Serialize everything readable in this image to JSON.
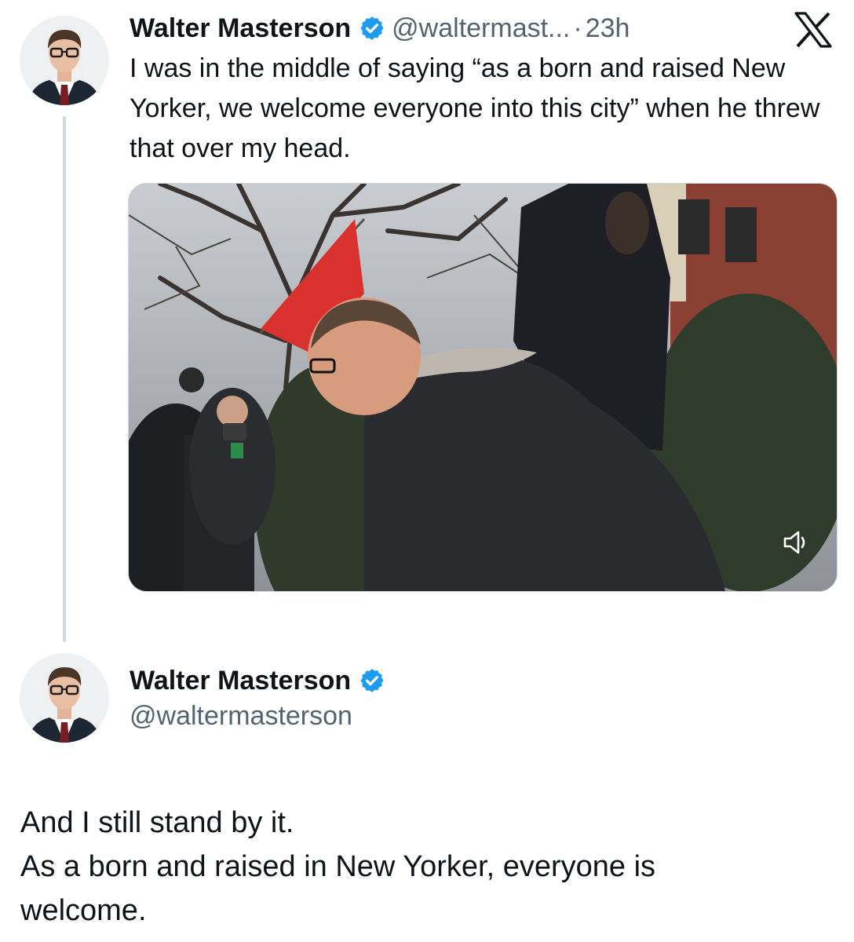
{
  "tweet": {
    "author_name": "Walter Masterson",
    "handle": "@waltermast...",
    "separator": "·",
    "time": "23h",
    "text": "I was in the middle of saying “as a born and raised New Yorker, we welcome everyone into this city” when he threw that over my head.",
    "media_type": "video",
    "media_control": "volume-muted-icon"
  },
  "reply": {
    "author_name": "Walter Masterson",
    "handle": "@waltermasterson"
  },
  "body": {
    "lines": [
      "And I still stand by it.",
      "As a born and raised in New Yorker, everyone is",
      "welcome."
    ]
  },
  "brand": {
    "logo": "x-logo",
    "verified_color": "#1d9bf0"
  }
}
